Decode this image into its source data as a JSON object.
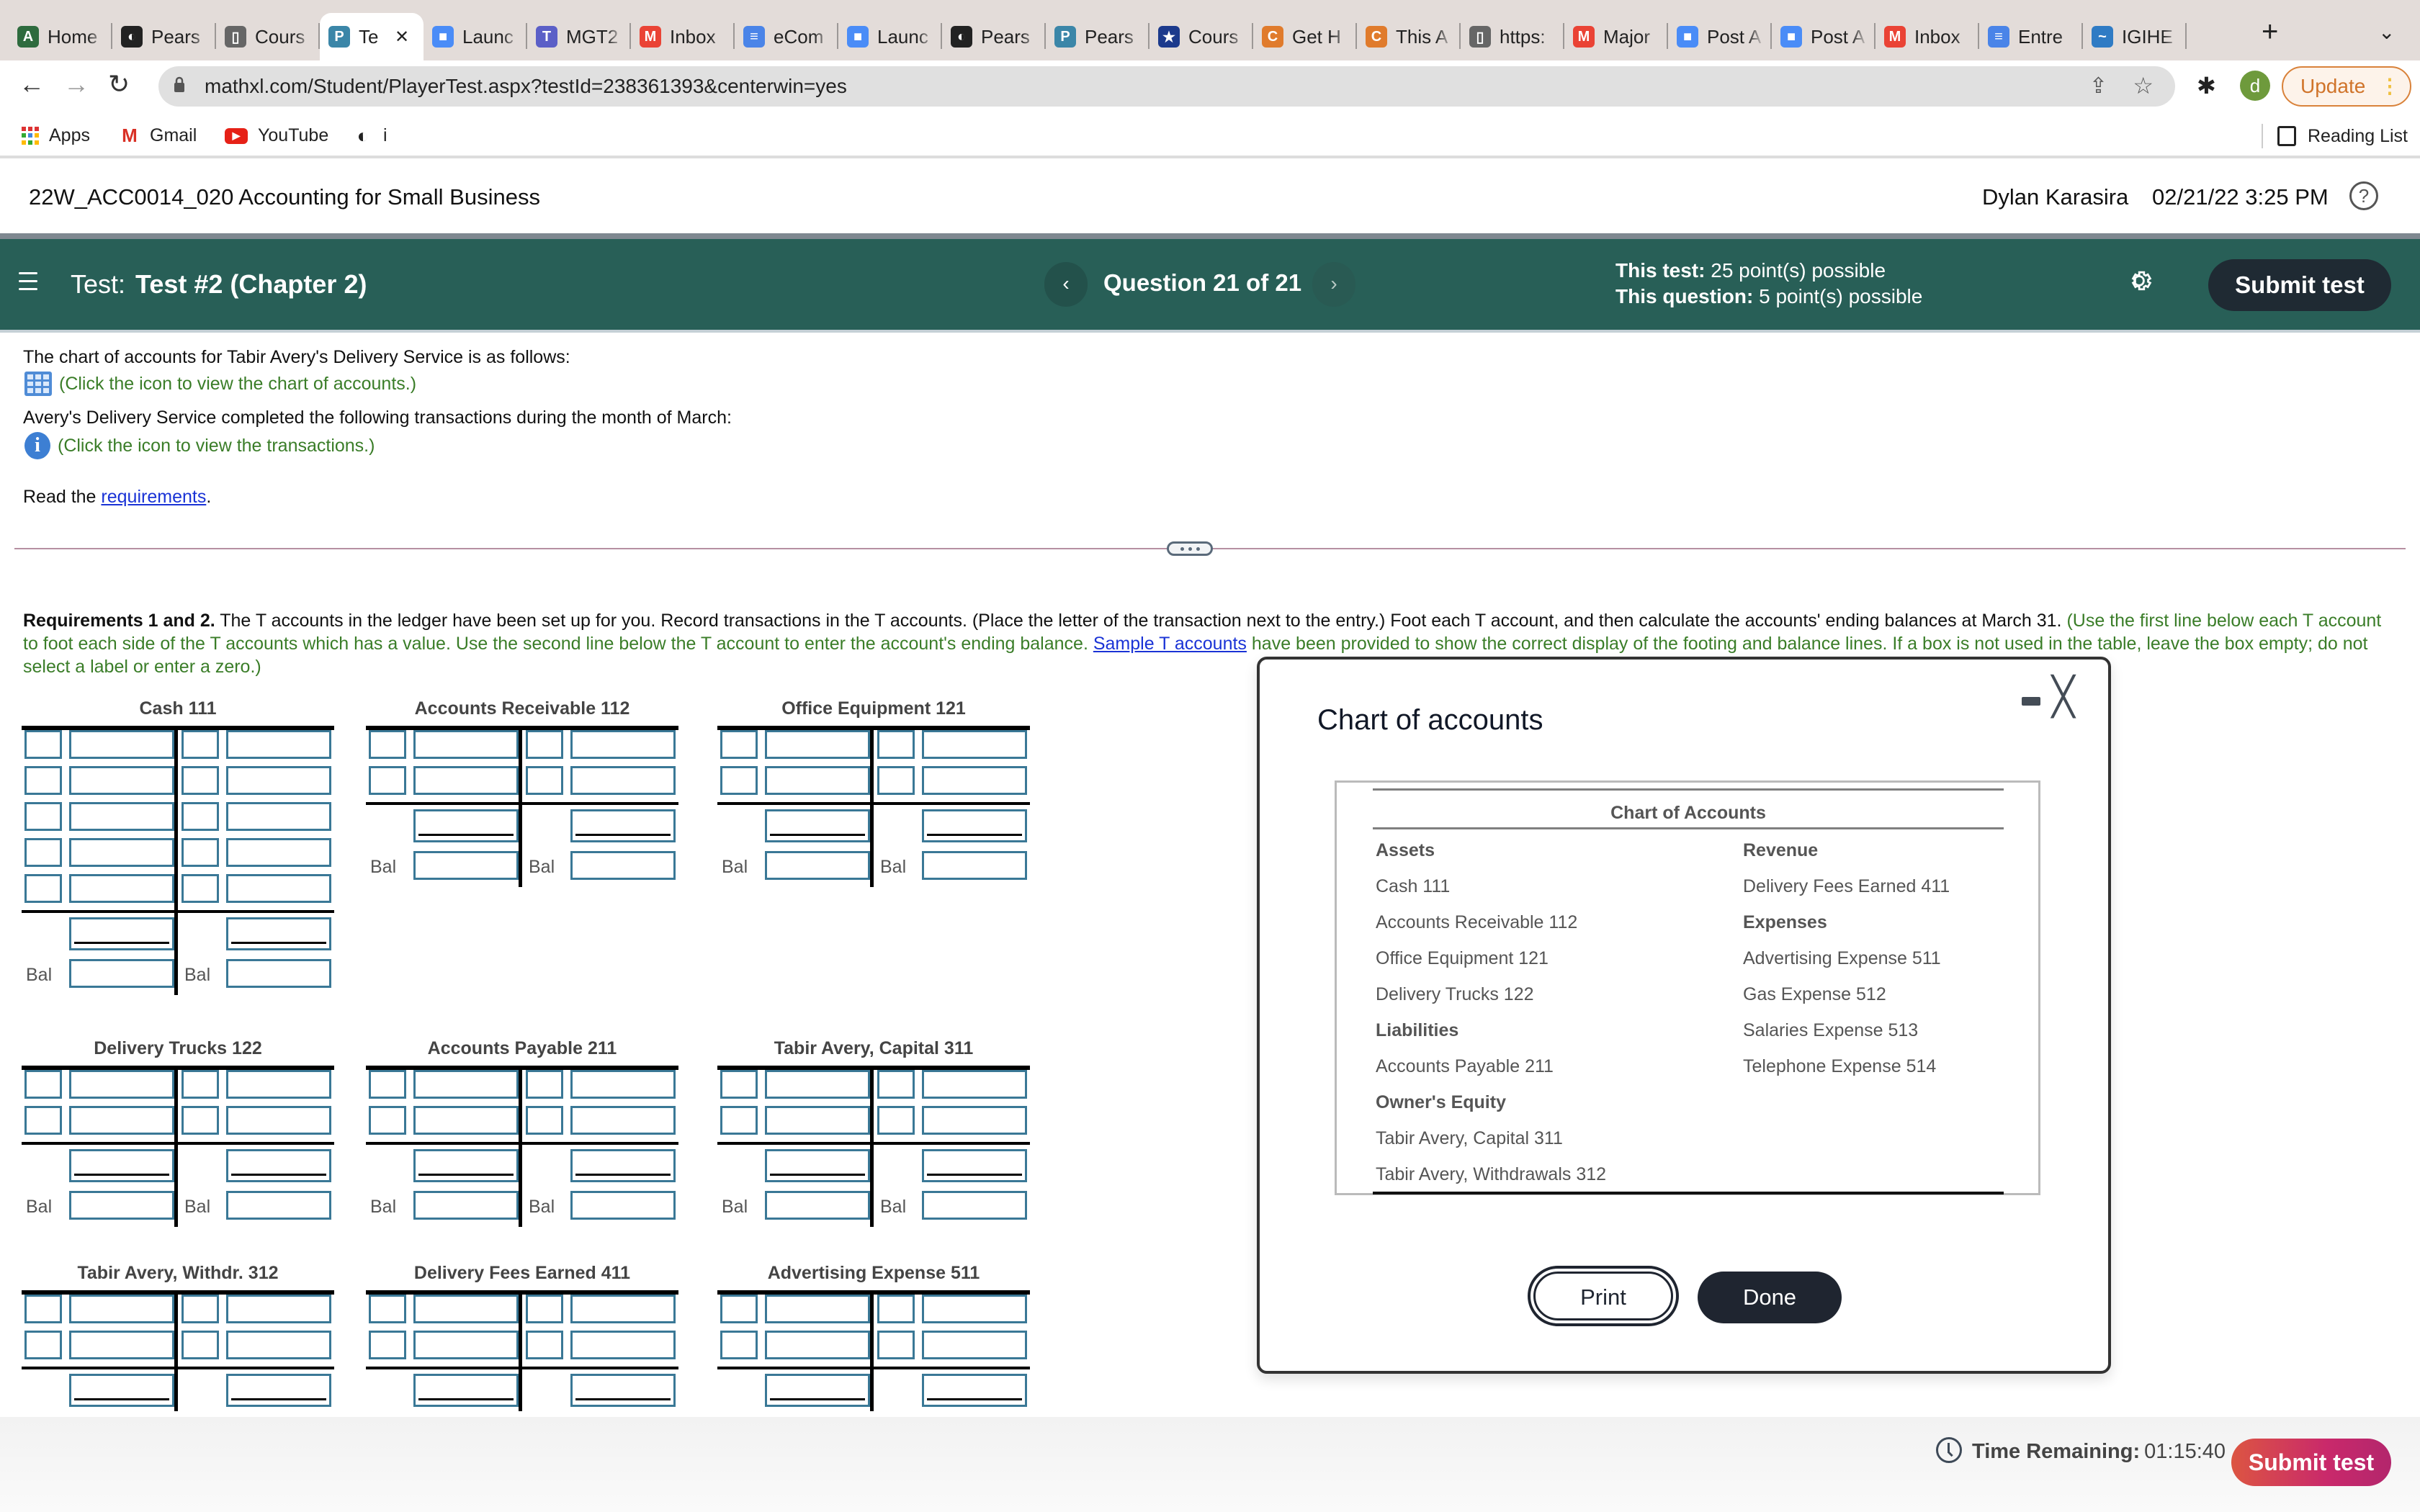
{
  "browser": {
    "tabs": [
      {
        "label": "Home",
        "icon": "aca-icon",
        "color": "#2e6b3e",
        "glyph": "A"
      },
      {
        "label": "Pears",
        "icon": "globe-icon",
        "color": "#222",
        "glyph": "◐"
      },
      {
        "label": "Cours",
        "icon": "page-icon",
        "color": "#666",
        "glyph": "▯"
      },
      {
        "label": "Te",
        "icon": "pearson-icon",
        "color": "#3b86a8",
        "glyph": "P",
        "active": true
      },
      {
        "label": "Launc",
        "icon": "zoom-icon",
        "color": "#4a8cf7",
        "glyph": "■"
      },
      {
        "label": "MGT2",
        "icon": "teams-icon",
        "color": "#5b5fc7",
        "glyph": "T"
      },
      {
        "label": "Inbox",
        "icon": "gmail-icon",
        "color": "#ea4335",
        "glyph": "M"
      },
      {
        "label": "eCom",
        "icon": "docs-icon",
        "color": "#4a84e8",
        "glyph": "≡"
      },
      {
        "label": "Launc",
        "icon": "zoom-icon",
        "color": "#4a8cf7",
        "glyph": "■"
      },
      {
        "label": "Pears",
        "icon": "globe-icon",
        "color": "#222",
        "glyph": "◐"
      },
      {
        "label": "Pears",
        "icon": "pearson-icon",
        "color": "#3b86a8",
        "glyph": "P"
      },
      {
        "label": "Cours",
        "icon": "star-shield-icon",
        "color": "#1c3a8c",
        "glyph": "★"
      },
      {
        "label": "Get H",
        "icon": "chegg-icon",
        "color": "#e07b2c",
        "glyph": "C"
      },
      {
        "label": "This A",
        "icon": "chegg-icon",
        "color": "#e07b2c",
        "glyph": "C"
      },
      {
        "label": "https:",
        "icon": "page-icon",
        "color": "#666",
        "glyph": "▯"
      },
      {
        "label": "Major",
        "icon": "gmail-icon",
        "color": "#ea4335",
        "glyph": "M"
      },
      {
        "label": "Post A",
        "icon": "zoom-icon",
        "color": "#4a8cf7",
        "glyph": "■"
      },
      {
        "label": "Post A",
        "icon": "zoom-icon",
        "color": "#4a8cf7",
        "glyph": "■"
      },
      {
        "label": "Inbox",
        "icon": "gmail-icon",
        "color": "#ea4335",
        "glyph": "M"
      },
      {
        "label": "Entre",
        "icon": "docs-icon",
        "color": "#4a84e8",
        "glyph": "≡"
      },
      {
        "label": "IGIHE",
        "icon": "igihe-icon",
        "color": "#2f7bc4",
        "glyph": "~"
      }
    ],
    "new_tab": "+",
    "tab_menu": "⌄",
    "url": "mathxl.com/Student/PlayerTest.aspx?testId=238361393&centerwin=yes",
    "profile_initial": "d",
    "update_label": "Update",
    "bookmarks": [
      {
        "label": "Apps",
        "icon": "apps-grid-icon"
      },
      {
        "label": "Gmail",
        "icon": "gmail-icon"
      },
      {
        "label": "YouTube",
        "icon": "youtube-icon"
      },
      {
        "label": "i",
        "icon": "globe-icon"
      }
    ],
    "reading_list": "Reading List"
  },
  "course": {
    "title": "22W_ACC0014_020 Accounting for Small Business",
    "user": "Dylan Karasira",
    "datetime": "02/21/22 3:25 PM",
    "help": "?"
  },
  "testbar": {
    "test_prefix": "Test:",
    "test_name": "Test #2 (Chapter 2)",
    "question": "Question 21 of 21",
    "test_points_label": "This test:",
    "test_points": "25 point(s) possible",
    "question_points_label": "This question:",
    "question_points": "5 point(s) possible",
    "submit": "Submit test"
  },
  "content": {
    "intro1": "The chart of accounts for Tabir Avery's Delivery Service is as follows:",
    "chart_link": "(Click the icon to view the chart of accounts.)",
    "intro2": "Avery's Delivery Service completed the following transactions during the month of March:",
    "trans_link": "(Click the icon to view the transactions.)",
    "read_prefix": "Read the ",
    "read_link": "requirements",
    "read_suffix": ".",
    "req_bold": "Requirements 1 and 2.",
    "req_text": " The T accounts in the ledger have been set up for you. Record transactions in the T accounts. (Place the letter of the transaction next to the entry.) Foot each T account, and then calculate the accounts' ending balances at March 31. ",
    "req_green1": "(Use the first line below each T account to foot each side of the T accounts which has a value. Use the second line below the T account to enter the account's ending balance. ",
    "req_link": "Sample T accounts",
    "req_green2": " have been provided to show the correct display of the footing and balance lines. If a box is not used in the table, leave the box empty; do not select a label or enter a zero.)"
  },
  "taccounts": [
    {
      "name": "Cash 111",
      "rows": 5,
      "bal": true
    },
    {
      "name": "Accounts Receivable 112",
      "rows": 2,
      "bal": true
    },
    {
      "name": "Office Equipment 121",
      "rows": 2,
      "bal": true
    },
    {
      "name": "Delivery Trucks 122",
      "rows": 2,
      "bal": true
    },
    {
      "name": "Accounts Payable 211",
      "rows": 2,
      "bal": true
    },
    {
      "name": "Tabir Avery, Capital 311",
      "rows": 2,
      "bal": true
    },
    {
      "name": "Tabir Avery, Withdr. 312",
      "rows": 2,
      "bal": false
    },
    {
      "name": "Delivery Fees Earned 411",
      "rows": 2,
      "bal": false
    },
    {
      "name": "Advertising Expense 511",
      "rows": 2,
      "bal": false
    }
  ],
  "bal_label": "Bal",
  "modal": {
    "title": "Chart of accounts",
    "table_title": "Chart of Accounts",
    "left": [
      {
        "text": "Assets",
        "bold": true
      },
      {
        "text": "Cash 111"
      },
      {
        "text": "Accounts Receivable 112"
      },
      {
        "text": "Office Equipment 121"
      },
      {
        "text": "Delivery Trucks 122"
      },
      {
        "text": "Liabilities",
        "bold": true
      },
      {
        "text": "Accounts Payable 211"
      },
      {
        "text": "Owner's Equity",
        "bold": true
      },
      {
        "text": "Tabir Avery, Capital 311"
      },
      {
        "text": "Tabir Avery, Withdrawals 312"
      }
    ],
    "right": [
      {
        "text": "Revenue",
        "bold": true
      },
      {
        "text": "Delivery Fees Earned 411"
      },
      {
        "text": "Expenses",
        "bold": true
      },
      {
        "text": "Advertising Expense 511"
      },
      {
        "text": "Gas Expense 512"
      },
      {
        "text": "Salaries Expense 513"
      },
      {
        "text": "Telephone Expense 514"
      }
    ],
    "print": "Print",
    "done": "Done"
  },
  "footer": {
    "time_label": "Time Remaining:",
    "time_value": "01:15:40",
    "submit": "Submit test"
  }
}
